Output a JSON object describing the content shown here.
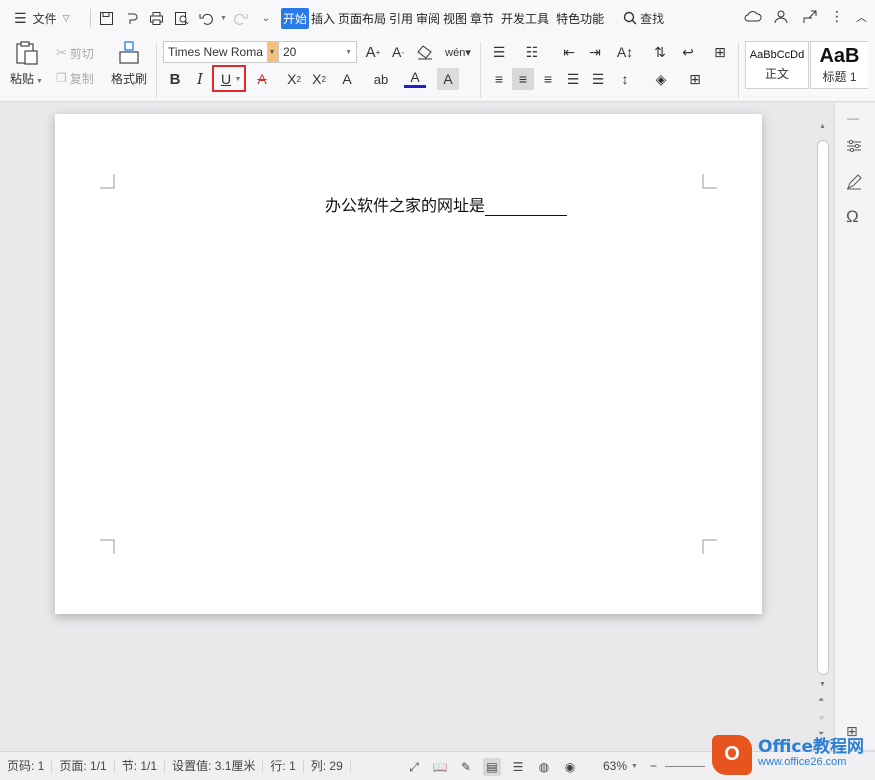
{
  "menubar": {
    "menu_label": "文件",
    "tabs": [
      "开始",
      "插入",
      "页面布局",
      "引用",
      "审阅",
      "视图",
      "章节",
      "开发工具",
      "特色功能"
    ],
    "active_tab": "开始",
    "search_label": "查找"
  },
  "ribbon": {
    "paste": "粘贴",
    "cut": "剪切",
    "copy": "复制",
    "format_painter": "格式刷",
    "font_name": "Times New Roma",
    "font_size": "20",
    "style_normal_preview": "AaBbCcDd",
    "style_normal_label": "正文",
    "style_h1_preview": "AaB",
    "style_h1_label": "标题 1",
    "colors": {
      "font_color_bar": "#1f1fcc",
      "highlight_box": "#e0282e",
      "active_tab_bg": "#2b79e6"
    }
  },
  "document": {
    "text": "办公软件之家的网址是"
  },
  "statusbar": {
    "page_no": "页码: 1",
    "pages": "页面: 1/1",
    "section": "节: 1/1",
    "setting": "设置值: 3.1厘米",
    "row": "行: 1",
    "col": "列: 29",
    "zoom": "63%"
  },
  "logo": {
    "mark": "O",
    "title": "Office教程网",
    "url": "www.office26.com"
  }
}
